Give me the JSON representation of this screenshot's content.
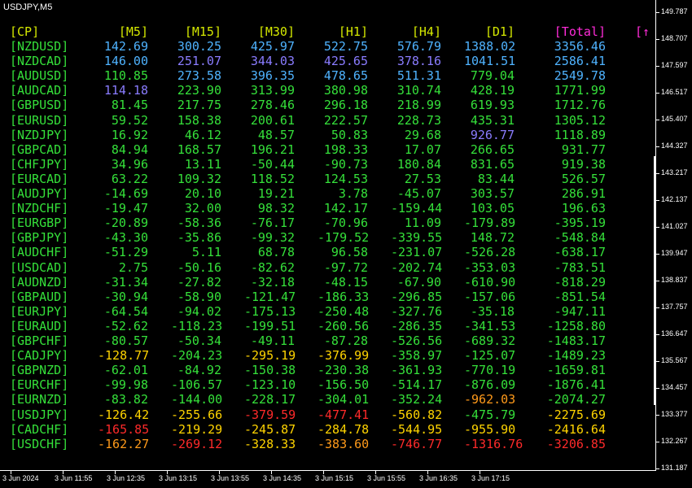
{
  "symbol_title": "USDJPY,M5",
  "headers": {
    "cp": "[CP]",
    "m5": "[M5]",
    "m15": "[M15]",
    "m30": "[M30]",
    "h1": "[H1]",
    "h4": "[H4]",
    "d1": "[D1]",
    "total": "[Total]",
    "arrow": "[↑"
  },
  "colors": {
    "header": "#d4e800",
    "pair": "#35e03a",
    "total_header": "#ff2bd8",
    "blue": "#4fb3ff",
    "purple": "#8a7cff",
    "green": "#35e03a",
    "yellow": "#ffd400",
    "orange": "#ff9a1a",
    "red": "#ff2a2a"
  },
  "rows": [
    {
      "pair": "[NZDUSD]",
      "m5": "142.69",
      "m15": "300.25",
      "m30": "425.97",
      "h1": "522.75",
      "h4": "576.79",
      "d1": "1388.02",
      "total": "3356.46",
      "c": [
        "blue",
        "blue",
        "blue",
        "blue",
        "blue",
        "blue",
        "blue"
      ]
    },
    {
      "pair": "[NZDCAD]",
      "m5": "146.00",
      "m15": "251.07",
      "m30": "344.03",
      "h1": "425.65",
      "h4": "378.16",
      "d1": "1041.51",
      "total": "2586.41",
      "c": [
        "blue",
        "purple",
        "purple",
        "purple",
        "purple",
        "blue",
        "blue"
      ]
    },
    {
      "pair": "[AUDUSD]",
      "m5": "110.85",
      "m15": "273.58",
      "m30": "396.35",
      "h1": "478.65",
      "h4": "511.31",
      "d1": "779.04",
      "total": "2549.78",
      "c": [
        "green",
        "blue",
        "blue",
        "blue",
        "blue",
        "green",
        "blue"
      ]
    },
    {
      "pair": "[AUDCAD]",
      "m5": "114.18",
      "m15": "223.90",
      "m30": "313.99",
      "h1": "380.98",
      "h4": "310.74",
      "d1": "428.19",
      "total": "1771.99",
      "c": [
        "purple",
        "green",
        "green",
        "green",
        "green",
        "green",
        "green"
      ]
    },
    {
      "pair": "[GBPUSD]",
      "m5": "81.45",
      "m15": "217.75",
      "m30": "278.46",
      "h1": "296.18",
      "h4": "218.99",
      "d1": "619.93",
      "total": "1712.76",
      "c": [
        "green",
        "green",
        "green",
        "green",
        "green",
        "green",
        "green"
      ]
    },
    {
      "pair": "[EURUSD]",
      "m5": "59.52",
      "m15": "158.38",
      "m30": "200.61",
      "h1": "222.57",
      "h4": "228.73",
      "d1": "435.31",
      "total": "1305.12",
      "c": [
        "green",
        "green",
        "green",
        "green",
        "green",
        "green",
        "green"
      ]
    },
    {
      "pair": "[NZDJPY]",
      "m5": "16.92",
      "m15": "46.12",
      "m30": "48.57",
      "h1": "50.83",
      "h4": "29.68",
      "d1": "926.77",
      "total": "1118.89",
      "c": [
        "green",
        "green",
        "green",
        "green",
        "green",
        "purple",
        "green"
      ]
    },
    {
      "pair": "[GBPCAD]",
      "m5": "84.94",
      "m15": "168.57",
      "m30": "196.21",
      "h1": "198.33",
      "h4": "17.07",
      "d1": "266.65",
      "total": "931.77",
      "c": [
        "green",
        "green",
        "green",
        "green",
        "green",
        "green",
        "green"
      ]
    },
    {
      "pair": "[CHFJPY]",
      "m5": "34.96",
      "m15": "13.11",
      "m30": "-50.44",
      "h1": "-90.73",
      "h4": "180.84",
      "d1": "831.65",
      "total": "919.38",
      "c": [
        "green",
        "green",
        "green",
        "green",
        "green",
        "green",
        "green"
      ]
    },
    {
      "pair": "[EURCAD]",
      "m5": "63.22",
      "m15": "109.32",
      "m30": "118.52",
      "h1": "124.53",
      "h4": "27.53",
      "d1": "83.44",
      "total": "526.57",
      "c": [
        "green",
        "green",
        "green",
        "green",
        "green",
        "green",
        "green"
      ]
    },
    {
      "pair": "[AUDJPY]",
      "m5": "-14.69",
      "m15": "20.10",
      "m30": "19.21",
      "h1": "3.78",
      "h4": "-45.07",
      "d1": "303.57",
      "total": "286.91",
      "c": [
        "green",
        "green",
        "green",
        "green",
        "green",
        "green",
        "green"
      ]
    },
    {
      "pair": "[NZDCHF]",
      "m5": "-19.47",
      "m15": "32.00",
      "m30": "98.32",
      "h1": "142.17",
      "h4": "-159.44",
      "d1": "103.05",
      "total": "196.63",
      "c": [
        "green",
        "green",
        "green",
        "green",
        "green",
        "green",
        "green"
      ]
    },
    {
      "pair": "[EURGBP]",
      "m5": "-20.89",
      "m15": "-58.36",
      "m30": "-76.17",
      "h1": "-70.96",
      "h4": "11.09",
      "d1": "-179.89",
      "total": "-395.19",
      "c": [
        "green",
        "green",
        "green",
        "green",
        "green",
        "green",
        "green"
      ]
    },
    {
      "pair": "[GBPJPY]",
      "m5": "-43.30",
      "m15": "-35.86",
      "m30": "-99.32",
      "h1": "-179.52",
      "h4": "-339.55",
      "d1": "148.72",
      "total": "-548.84",
      "c": [
        "green",
        "green",
        "green",
        "green",
        "green",
        "green",
        "green"
      ]
    },
    {
      "pair": "[AUDCHF]",
      "m5": "-51.29",
      "m15": "5.11",
      "m30": "68.78",
      "h1": "96.58",
      "h4": "-231.07",
      "d1": "-526.28",
      "total": "-638.17",
      "c": [
        "green",
        "green",
        "green",
        "green",
        "green",
        "green",
        "green"
      ]
    },
    {
      "pair": "[USDCAD]",
      "m5": "2.75",
      "m15": "-50.16",
      "m30": "-82.62",
      "h1": "-97.72",
      "h4": "-202.74",
      "d1": "-353.03",
      "total": "-783.51",
      "c": [
        "green",
        "green",
        "green",
        "green",
        "green",
        "green",
        "green"
      ]
    },
    {
      "pair": "[AUDNZD]",
      "m5": "-31.34",
      "m15": "-27.82",
      "m30": "-32.18",
      "h1": "-48.15",
      "h4": "-67.90",
      "d1": "-610.90",
      "total": "-818.29",
      "c": [
        "green",
        "green",
        "green",
        "green",
        "green",
        "green",
        "green"
      ]
    },
    {
      "pair": "[GBPAUD]",
      "m5": "-30.94",
      "m15": "-58.90",
      "m30": "-121.47",
      "h1": "-186.33",
      "h4": "-296.85",
      "d1": "-157.06",
      "total": "-851.54",
      "c": [
        "green",
        "green",
        "green",
        "green",
        "green",
        "green",
        "green"
      ]
    },
    {
      "pair": "[EURJPY]",
      "m5": "-64.54",
      "m15": "-94.02",
      "m30": "-175.13",
      "h1": "-250.48",
      "h4": "-327.76",
      "d1": "-35.18",
      "total": "-947.11",
      "c": [
        "green",
        "green",
        "green",
        "green",
        "green",
        "green",
        "green"
      ]
    },
    {
      "pair": "[EURAUD]",
      "m5": "-52.62",
      "m15": "-118.23",
      "m30": "-199.51",
      "h1": "-260.56",
      "h4": "-286.35",
      "d1": "-341.53",
      "total": "-1258.80",
      "c": [
        "green",
        "green",
        "green",
        "green",
        "green",
        "green",
        "green"
      ]
    },
    {
      "pair": "[GBPCHF]",
      "m5": "-80.57",
      "m15": "-50.34",
      "m30": "-49.11",
      "h1": "-87.28",
      "h4": "-526.56",
      "d1": "-689.32",
      "total": "-1483.17",
      "c": [
        "green",
        "green",
        "green",
        "green",
        "green",
        "green",
        "green"
      ]
    },
    {
      "pair": "[CADJPY]",
      "m5": "-128.77",
      "m15": "-204.23",
      "m30": "-295.19",
      "h1": "-376.99",
      "h4": "-358.97",
      "d1": "-125.07",
      "total": "-1489.23",
      "c": [
        "yellow",
        "green",
        "yellow",
        "yellow",
        "green",
        "green",
        "green"
      ]
    },
    {
      "pair": "[GBPNZD]",
      "m5": "-62.01",
      "m15": "-84.92",
      "m30": "-150.38",
      "h1": "-230.38",
      "h4": "-361.93",
      "d1": "-770.19",
      "total": "-1659.81",
      "c": [
        "green",
        "green",
        "green",
        "green",
        "green",
        "green",
        "green"
      ]
    },
    {
      "pair": "[EURCHF]",
      "m5": "-99.98",
      "m15": "-106.57",
      "m30": "-123.10",
      "h1": "-156.50",
      "h4": "-514.17",
      "d1": "-876.09",
      "total": "-1876.41",
      "c": [
        "green",
        "green",
        "green",
        "green",
        "green",
        "green",
        "green"
      ]
    },
    {
      "pair": "[EURNZD]",
      "m5": "-83.82",
      "m15": "-144.00",
      "m30": "-228.17",
      "h1": "-304.01",
      "h4": "-352.24",
      "d1": "-962.03",
      "total": "-2074.27",
      "c": [
        "green",
        "green",
        "green",
        "green",
        "green",
        "orange",
        "green"
      ]
    },
    {
      "pair": "[USDJPY]",
      "m5": "-126.42",
      "m15": "-255.66",
      "m30": "-379.59",
      "h1": "-477.41",
      "h4": "-560.82",
      "d1": "-475.79",
      "total": "-2275.69",
      "c": [
        "yellow",
        "yellow",
        "red",
        "red",
        "yellow",
        "green",
        "yellow"
      ]
    },
    {
      "pair": "[CADCHF]",
      "m5": "-165.85",
      "m15": "-219.29",
      "m30": "-245.87",
      "h1": "-284.78",
      "h4": "-544.95",
      "d1": "-955.90",
      "total": "-2416.64",
      "c": [
        "red",
        "yellow",
        "yellow",
        "yellow",
        "yellow",
        "yellow",
        "yellow"
      ]
    },
    {
      "pair": "[USDCHF]",
      "m5": "-162.27",
      "m15": "-269.12",
      "m30": "-328.33",
      "h1": "-383.60",
      "h4": "-746.77",
      "d1": "-1316.76",
      "total": "-3206.85",
      "c": [
        "orange",
        "red",
        "yellow",
        "orange",
        "red",
        "red",
        "red"
      ]
    }
  ],
  "price_scale": [
    "149.787",
    "148.707",
    "147.597",
    "146.517",
    "145.407",
    "144.327",
    "143.217",
    "142.137",
    "141.027",
    "139.947",
    "138.837",
    "137.757",
    "136.647",
    "135.567",
    "134.457",
    "133.377",
    "132.267",
    "131.187"
  ],
  "time_labels": [
    "3 Jun 2024",
    "3 Jun 11:55",
    "3 Jun 12:35",
    "3 Jun 13:15",
    "3 Jun 13:55",
    "3 Jun 14:35",
    "3 Jun 15:15",
    "3 Jun 15:55",
    "3 Jun 16:35",
    "3 Jun 17:15"
  ]
}
